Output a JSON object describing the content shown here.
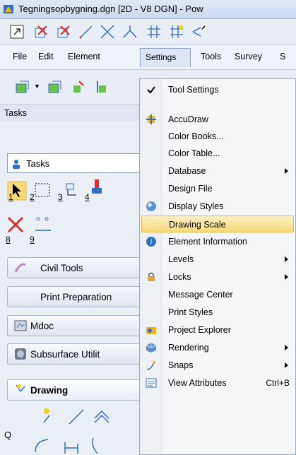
{
  "window": {
    "title": "Tegningsopbygning.dgn [2D - V8 DGN] - Pow"
  },
  "menubar": {
    "items": [
      "File",
      "Edit",
      "Element",
      "Settings",
      "Tools",
      "Survey",
      "S"
    ]
  },
  "tasks": {
    "title": "Tasks",
    "dropdown_label": "Tasks",
    "tool_numbers": [
      "1",
      "2",
      "3",
      "4",
      "8",
      "9"
    ],
    "groups": [
      "Civil Tools",
      "Print Preparation",
      "Mdoc",
      "Subsurface Utilit",
      "Drawing"
    ],
    "q_label": "Q"
  },
  "settings_menu": {
    "items": [
      {
        "label": "Tool Settings",
        "icon": "checkmark-icon",
        "submenu": false
      },
      {
        "label": "AccuDraw",
        "icon": "accudraw-icon",
        "submenu": false
      },
      {
        "label": "Color Books...",
        "icon": "",
        "submenu": false
      },
      {
        "label": "Color Table...",
        "icon": "",
        "submenu": false
      },
      {
        "label": "Database",
        "icon": "",
        "submenu": true
      },
      {
        "label": "Design File",
        "icon": "",
        "submenu": false
      },
      {
        "label": "Display Styles",
        "icon": "display-styles-icon",
        "submenu": false
      },
      {
        "label": "Drawing Scale",
        "icon": "",
        "submenu": false,
        "highlighted": true
      },
      {
        "label": "Element Information",
        "icon": "info-icon",
        "submenu": false
      },
      {
        "label": "Levels",
        "icon": "",
        "submenu": true
      },
      {
        "label": "Locks",
        "icon": "lock-icon",
        "submenu": true
      },
      {
        "label": "Message Center",
        "icon": "",
        "submenu": false
      },
      {
        "label": "Print Styles",
        "icon": "",
        "submenu": false
      },
      {
        "label": "Project Explorer",
        "icon": "project-explorer-icon",
        "submenu": false
      },
      {
        "label": "Rendering",
        "icon": "rendering-icon",
        "submenu": true
      },
      {
        "label": "Snaps",
        "icon": "snaps-icon",
        "submenu": true
      },
      {
        "label": "View Attributes",
        "icon": "view-attributes-icon",
        "submenu": false,
        "accelerator": "Ctrl+B"
      }
    ]
  },
  "colors": {
    "highlight": "#f9d97a",
    "accent_red": "#d9302c",
    "accent_blue": "#2f6fc4"
  }
}
